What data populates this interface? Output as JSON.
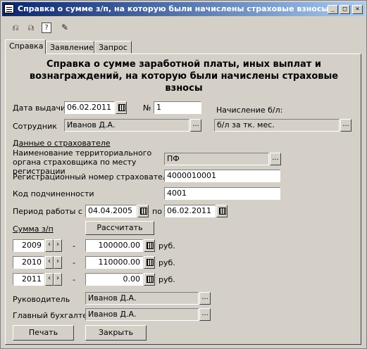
{
  "window": {
    "title": "Справка о сумме з/п, на которую были начислены страховые взносы",
    "min_glyph": "_",
    "max_glyph": "□",
    "close_glyph": "✕"
  },
  "toolbar": {
    "icon1": "⎌",
    "icon2": "⎌",
    "help": "?",
    "pin": "✎"
  },
  "tabs": [
    {
      "label": "Справка"
    },
    {
      "label": "Заявление"
    },
    {
      "label": "Запрос"
    }
  ],
  "heading": "Справка о сумме заработной платы, иных выплат и вознаграждений, на которую были начислены страховые взносы",
  "form": {
    "issue_date_label": "Дата выдачи",
    "issue_date": "06.02.2011",
    "number_label": "№",
    "number": "1",
    "accrual_label": "Начисление б/л:",
    "accrual_value": "б/л за тк. мес.",
    "employee_label": "Сотрудник",
    "employee": "Иванов Д.А.",
    "insurer_section": "Данные о страхователе",
    "terr_org_label": "Наименование территориального органа страховщика по месту регистрации",
    "terr_org": "ПФ",
    "reg_number_label": "Регистрационный номер страхователя",
    "reg_number": "4000010001",
    "sub_code_label": "Код подчиненности",
    "sub_code": "4001",
    "period_label": "Период работы с",
    "period_from": "04.04.2005",
    "period_to_label": "по",
    "period_to": "06.02.2011",
    "salary_label": "Сумма з/п",
    "calc_button": "Рассчитать",
    "dash": "-",
    "currency": "руб.",
    "salary_rows": [
      {
        "year": "2009",
        "amount": "100000.00"
      },
      {
        "year": "2010",
        "amount": "110000.00"
      },
      {
        "year": "2011",
        "amount": "0.00"
      }
    ],
    "head_label": "Руководитель",
    "head": "Иванов Д.А.",
    "accountant_label": "Главный бухгалтер",
    "accountant": "Иванов Д.А.",
    "ellipsis": "...",
    "prev": "‹",
    "next": "›"
  },
  "buttons": {
    "print": "Печать",
    "close": "Закрыть"
  }
}
